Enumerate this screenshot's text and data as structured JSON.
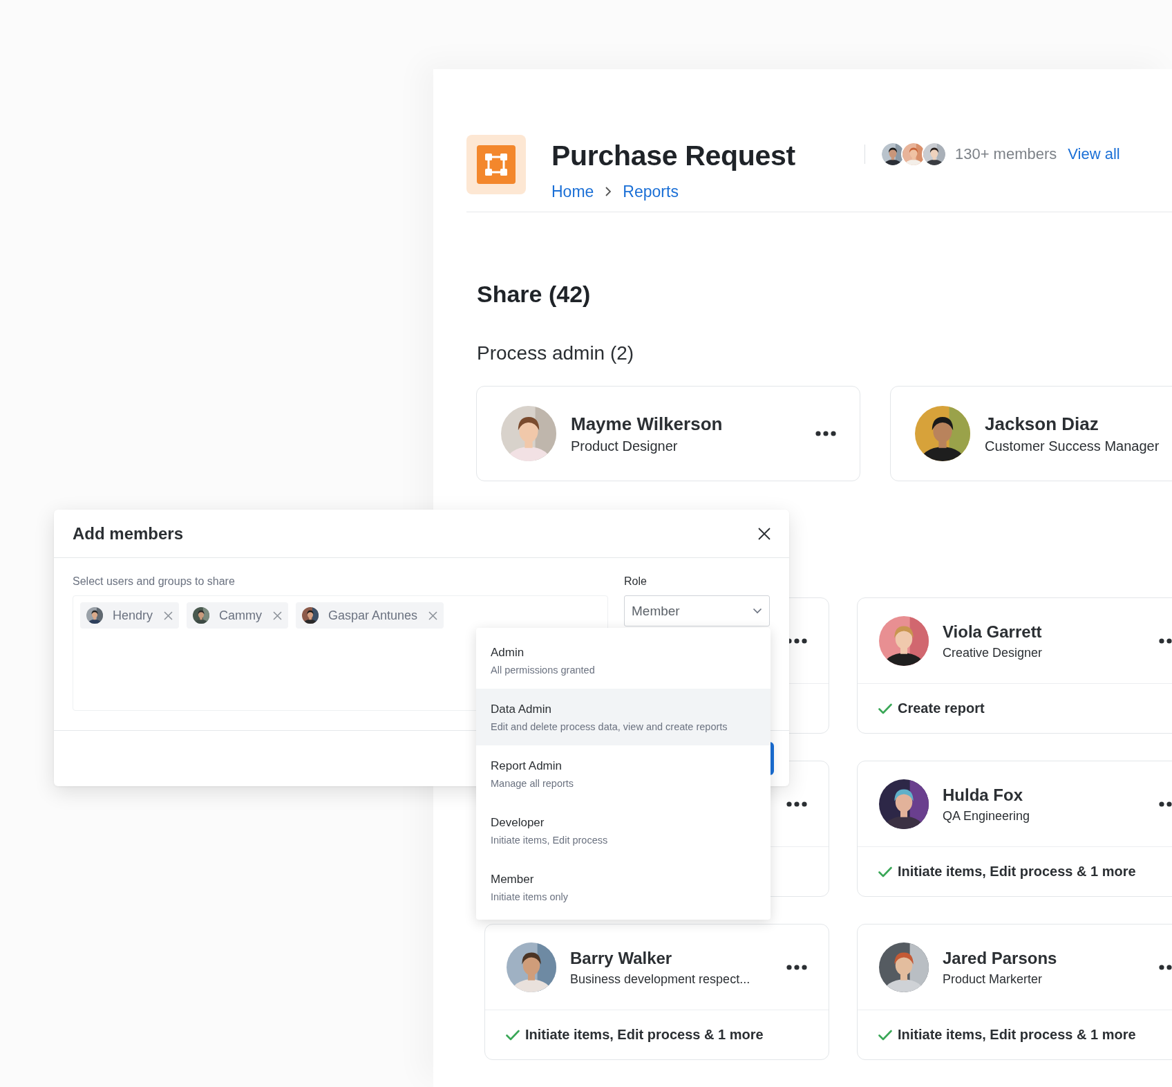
{
  "header": {
    "title": "Purchase Request",
    "breadcrumb": [
      {
        "label": "Home"
      },
      {
        "label": "Reports"
      }
    ],
    "member_count": "130+ members",
    "view_all": "View all"
  },
  "share_title": "Share (42)",
  "process_admin": {
    "title": "Process admin (2)",
    "members": [
      {
        "name": "Mayme Wilkerson",
        "role": "Product Designer",
        "menu": true
      },
      {
        "name": "Jackson Diaz",
        "role": "Customer Success Manager",
        "menu": false
      }
    ]
  },
  "member_cards": [
    {
      "menu": true
    },
    {
      "name": "Viola Garrett",
      "role": "Creative Designer",
      "permission": "Create report",
      "menu": true
    },
    {
      "menu": true
    },
    {
      "name": "Hulda Fox",
      "role": "QA Engineering",
      "permission": "Initiate items, Edit process & 1 more",
      "menu": true
    },
    {
      "name": "Barry Walker",
      "role": "Business development respect...",
      "permission": "Initiate items, Edit process & 1 more",
      "menu": true
    },
    {
      "name": "Jared Parsons",
      "role": "Product Markerter",
      "permission": "Initiate items, Edit process & 1 more",
      "menu": true
    }
  ],
  "modal": {
    "title": "Add members",
    "field_label": "Select users and groups to share",
    "chips": [
      {
        "label": "Hendry"
      },
      {
        "label": "Cammy"
      },
      {
        "label": "Gaspar Antunes"
      }
    ],
    "role_label": "Role",
    "role_value": "Member",
    "footer_button": {
      "kind": "primary"
    },
    "options": [
      {
        "title": "Admin",
        "description": "All permissions granted",
        "hovered": false
      },
      {
        "title": "Data Admin",
        "description": "Edit and delete process data, view and create reports",
        "hovered": true
      },
      {
        "title": "Report Admin",
        "description": "Manage all reports",
        "hovered": false
      },
      {
        "title": "Developer",
        "description": "Initiate items, Edit process",
        "hovered": false
      },
      {
        "title": "Member",
        "description": "Initiate items only",
        "hovered": false
      }
    ]
  }
}
